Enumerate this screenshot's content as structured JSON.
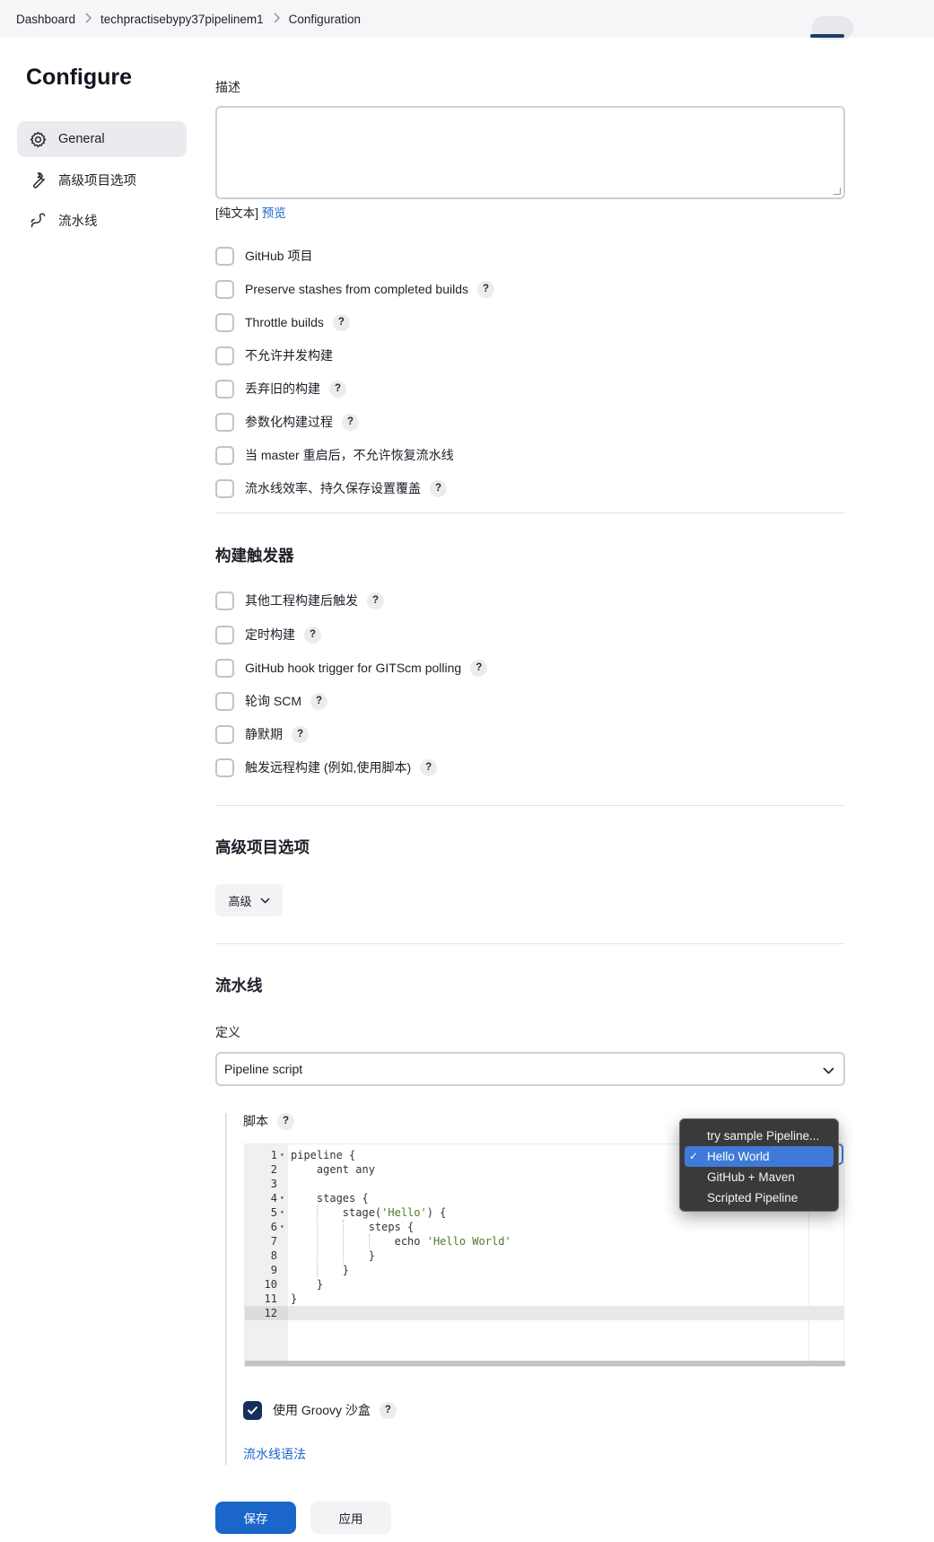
{
  "breadcrumb": [
    "Dashboard",
    "techpractisebypy37pipelinem1",
    "Configuration"
  ],
  "sidebar": {
    "title": "Configure",
    "items": [
      {
        "label": "General",
        "icon": "gear-icon",
        "active": true
      },
      {
        "label": "高级项目选项",
        "icon": "wrench-icon",
        "active": false
      },
      {
        "label": "流水线",
        "icon": "pipeline-icon",
        "active": false
      }
    ]
  },
  "general": {
    "description_label": "描述",
    "description_value": "",
    "plain_text_label": "[纯文本]",
    "preview_link": "预览",
    "options": [
      {
        "label": "GitHub 项目",
        "help": false,
        "checked": false
      },
      {
        "label": "Preserve stashes from completed builds",
        "help": true,
        "checked": false
      },
      {
        "label": "Throttle builds",
        "help": true,
        "checked": false
      },
      {
        "label": "不允许并发构建",
        "help": false,
        "checked": false
      },
      {
        "label": "丢弃旧的构建",
        "help": true,
        "checked": false
      },
      {
        "label": "参数化构建过程",
        "help": true,
        "checked": false
      },
      {
        "label": "当 master 重启后，不允许恢复流水线",
        "help": false,
        "checked": false
      },
      {
        "label": "流水线效率、持久保存设置覆盖",
        "help": true,
        "checked": false
      }
    ]
  },
  "triggers": {
    "title": "构建触发器",
    "options": [
      {
        "label": "其他工程构建后触发",
        "help": true,
        "checked": false
      },
      {
        "label": "定时构建",
        "help": true,
        "checked": false
      },
      {
        "label": "GitHub hook trigger for GITScm polling",
        "help": true,
        "checked": false
      },
      {
        "label": "轮询 SCM",
        "help": true,
        "checked": false
      },
      {
        "label": "静默期",
        "help": true,
        "checked": false
      },
      {
        "label": "触发远程构建 (例如,使用脚本)",
        "help": true,
        "checked": false
      }
    ]
  },
  "advanced": {
    "title": "高级项目选项",
    "button_label": "高级"
  },
  "pipeline": {
    "title": "流水线",
    "definition_label": "定义",
    "definition_value": "Pipeline script",
    "script_label": "脚本",
    "code_lines": [
      "pipeline {",
      "    agent any",
      "",
      "    stages {",
      "        stage('Hello') {",
      "            steps {",
      "                echo 'Hello World'",
      "            }",
      "        }",
      "    }",
      "}",
      ""
    ],
    "sample_menu": {
      "options": [
        "try sample Pipeline...",
        "Hello World",
        "GitHub + Maven",
        "Scripted Pipeline"
      ],
      "selected": "Hello World"
    },
    "sandbox_label": "使用 Groovy 沙盒",
    "sandbox_checked": true,
    "syntax_link": "流水线语法"
  },
  "actions": {
    "save": "保存",
    "apply": "应用"
  },
  "colors": {
    "primary": "#1a66c9",
    "checkbox_checked": "#14305a",
    "menu_highlight": "#3f7ad8"
  }
}
